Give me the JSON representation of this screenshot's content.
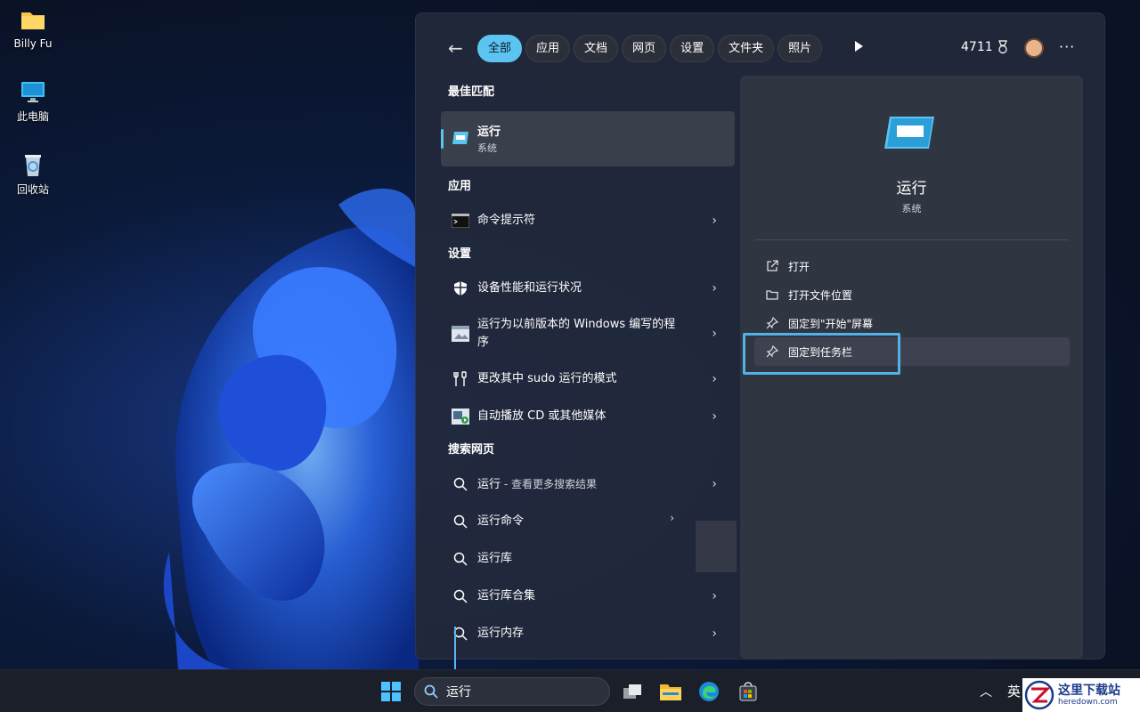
{
  "desktop": {
    "icons": [
      {
        "label": "Billy Fu",
        "icon": "folder-icon"
      },
      {
        "label": "此电脑",
        "icon": "monitor-icon"
      },
      {
        "label": "回收站",
        "icon": "recycle-bin-icon"
      }
    ]
  },
  "panel": {
    "filters": [
      "全部",
      "应用",
      "文档",
      "网页",
      "设置",
      "文件夹",
      "照片"
    ],
    "active_filter": "全部",
    "points": "4711",
    "best_match": {
      "header": "最佳匹配",
      "title": "运行",
      "subtitle": "系统"
    },
    "sections": {
      "apps": {
        "header": "应用",
        "items": [
          {
            "label": "命令提示符",
            "icon": "cmd-icon"
          }
        ]
      },
      "settings": {
        "header": "设置",
        "items": [
          {
            "label": "设备性能和运行状况",
            "icon": "shield-icon"
          },
          {
            "label": "运行为以前版本的 Windows 编写的程序",
            "icon": "compat-icon"
          },
          {
            "label": "更改其中 sudo 运行的模式",
            "icon": "tools-icon"
          },
          {
            "label": "自动播放 CD 或其他媒体",
            "icon": "autoplay-icon"
          }
        ]
      },
      "web": {
        "header": "搜索网页",
        "items": [
          {
            "label": "运行",
            "suffix": " - 查看更多搜索结果"
          },
          {
            "label": "运行命令"
          },
          {
            "label": "运行库"
          },
          {
            "label": "运行库合集"
          },
          {
            "label": "运行内存"
          }
        ]
      }
    },
    "preview": {
      "title": "运行",
      "subtitle": "系统",
      "actions": [
        {
          "label": "打开",
          "icon": "open-external-icon"
        },
        {
          "label": "打开文件位置",
          "icon": "folder-outline-icon"
        },
        {
          "label": "固定到\"开始\"屏幕",
          "icon": "pin-icon"
        },
        {
          "label": "固定到任务栏",
          "icon": "pin-icon"
        }
      ]
    }
  },
  "taskbar": {
    "search_value": "运行",
    "ime": "英"
  },
  "watermark": {
    "line1": "这里下载站",
    "line2": "heredown.com"
  }
}
